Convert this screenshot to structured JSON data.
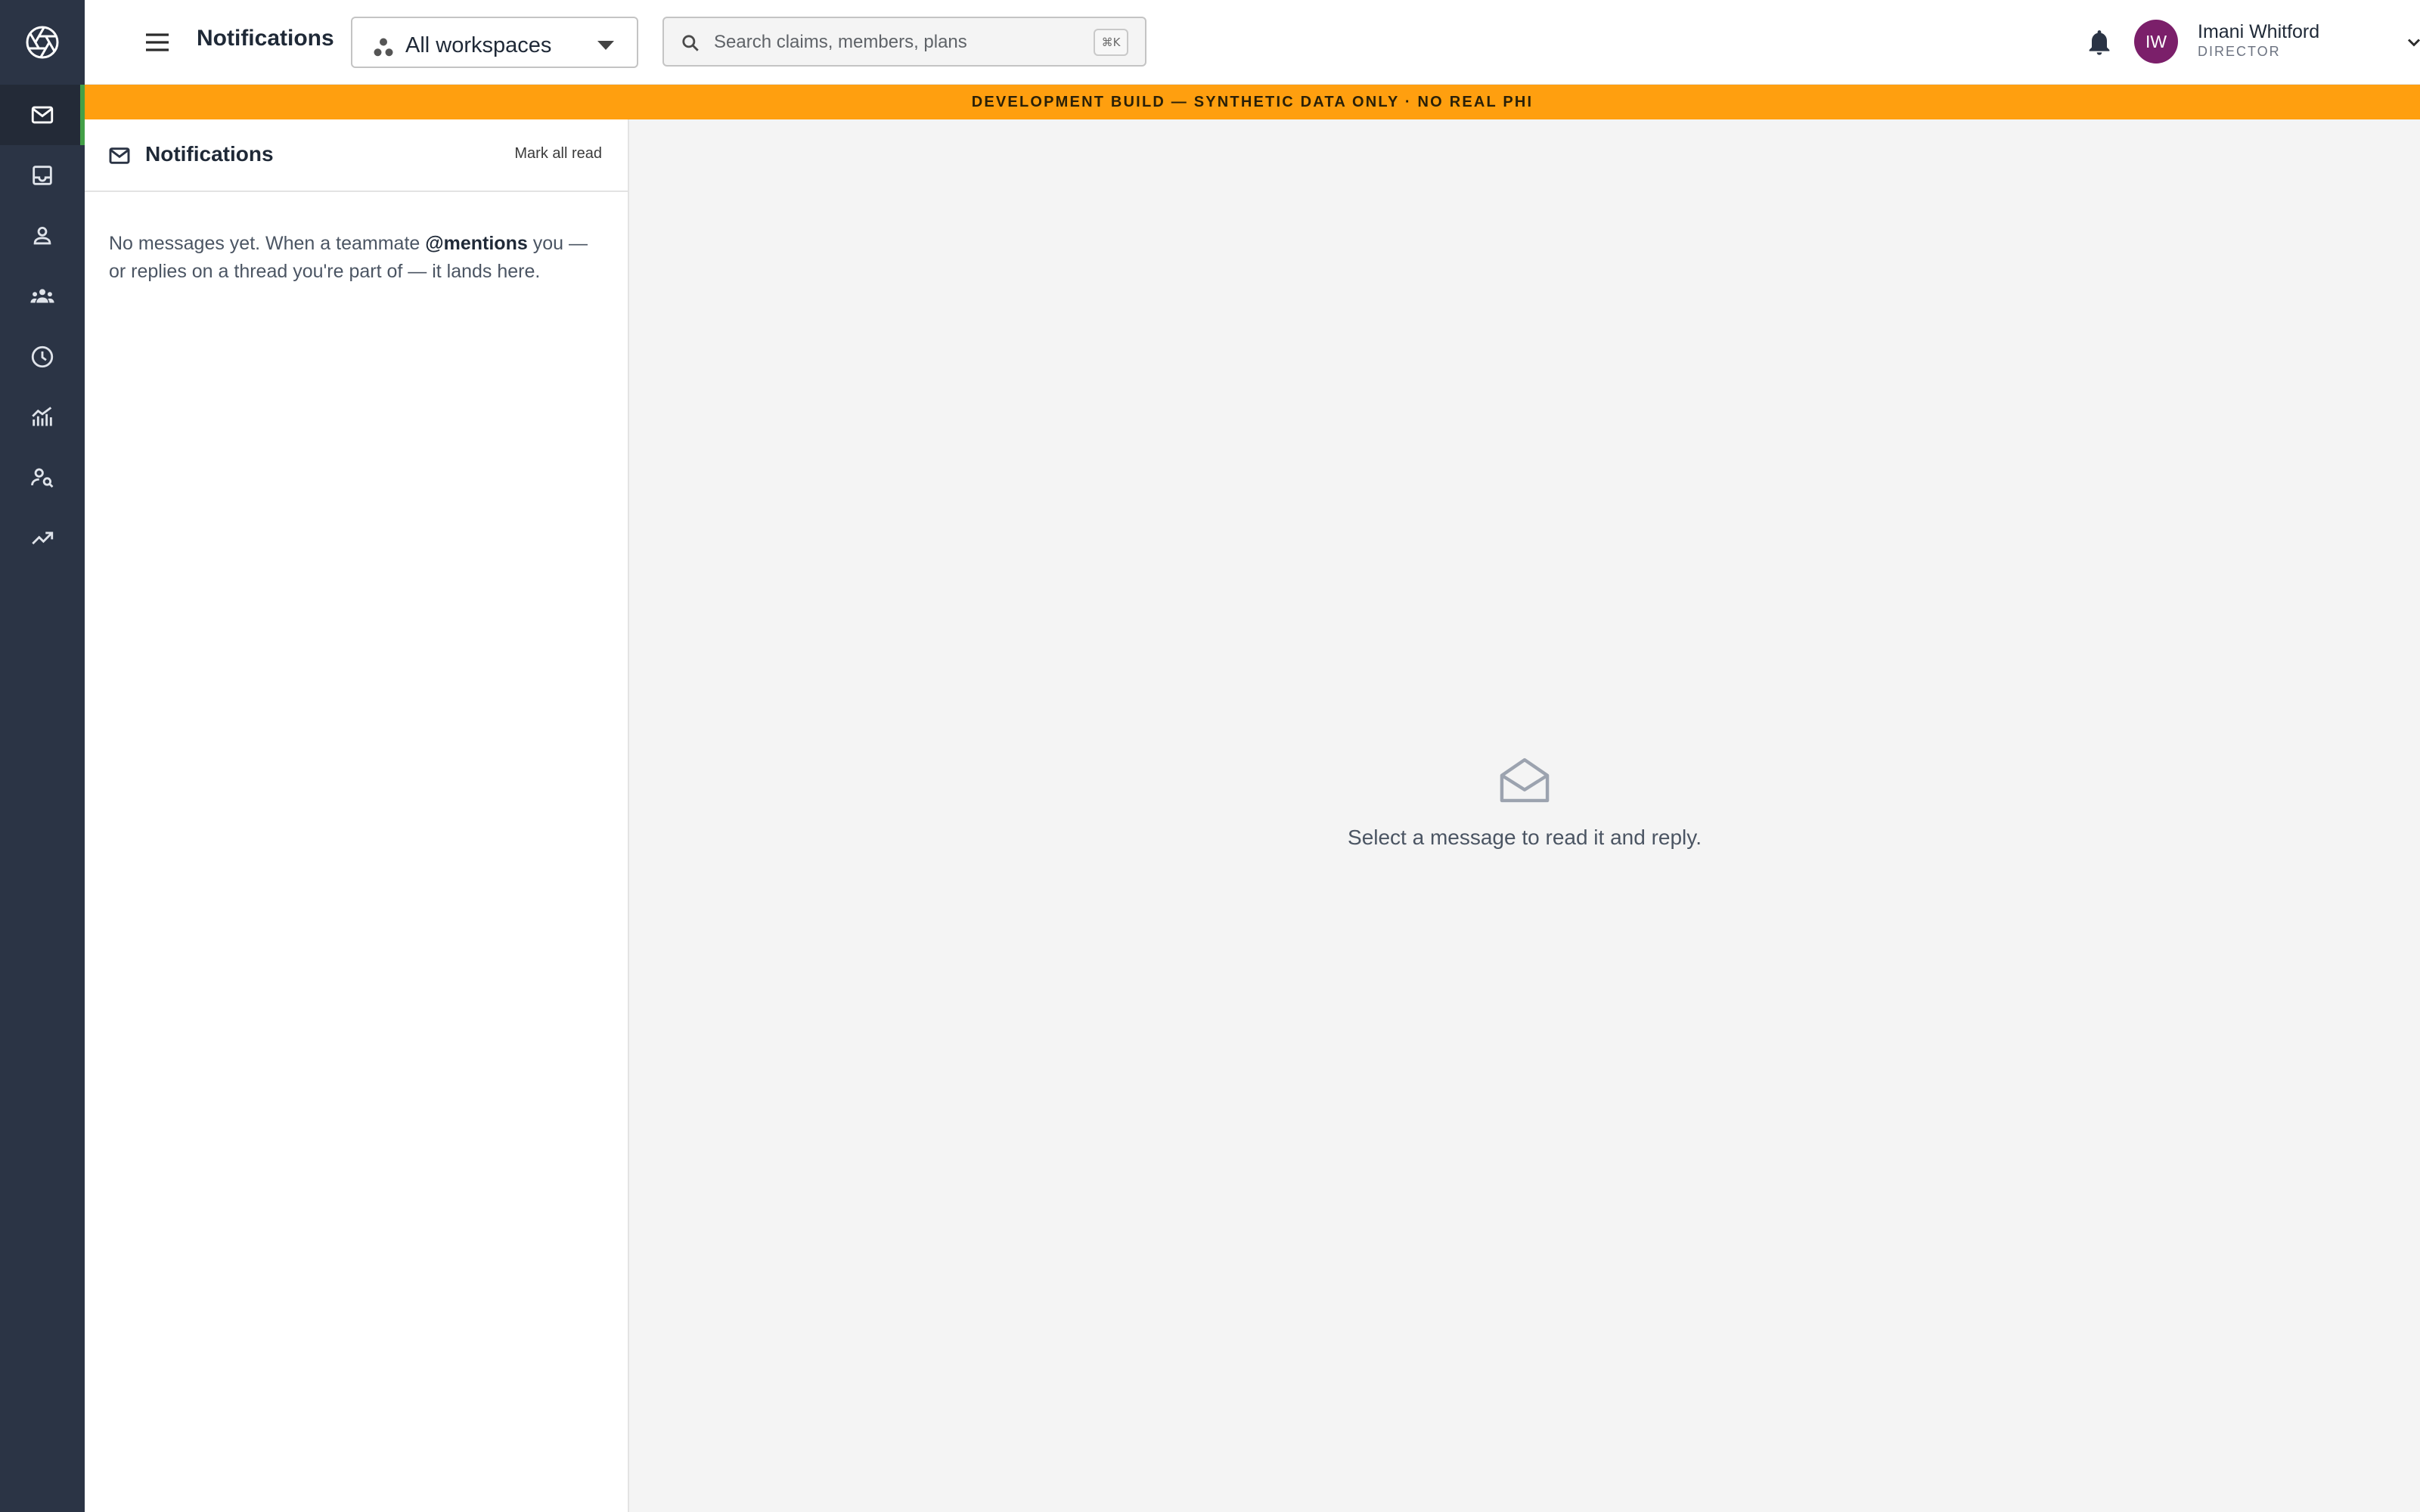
{
  "topbar": {
    "title": "Notifications",
    "workspace_select": "All workspaces",
    "search_placeholder": "Search claims, members, plans",
    "search_shortcut": "⌘K",
    "user": {
      "initials": "IW",
      "name": "Imani Whitford",
      "role": "DIRECTOR",
      "avatar_color": "#7b1f6a"
    }
  },
  "banner": {
    "text": "DEVELOPMENT BUILD — SYNTHETIC DATA ONLY · NO REAL PHI",
    "color": "#ff9f0f"
  },
  "sidebar": {
    "items": [
      {
        "icon": "mail-icon",
        "active": true
      },
      {
        "icon": "inbox-icon",
        "active": false
      },
      {
        "icon": "person-icon",
        "active": false
      },
      {
        "icon": "group-icon",
        "active": false
      },
      {
        "icon": "clock-icon",
        "active": false
      },
      {
        "icon": "analytics-icon",
        "active": false
      },
      {
        "icon": "person-search-icon",
        "active": false
      },
      {
        "icon": "trending-up-icon",
        "active": false
      }
    ],
    "active_color": "#43a047"
  },
  "panel": {
    "title": "Notifications",
    "mark_all_read": "Mark all read",
    "empty": {
      "before": "No messages yet. When a teammate ",
      "mention": "@mentions",
      "after": " you — or replies on a thread you're part of — it lands here."
    }
  },
  "reading_pane": {
    "message": "Select a message to read it and reply."
  }
}
